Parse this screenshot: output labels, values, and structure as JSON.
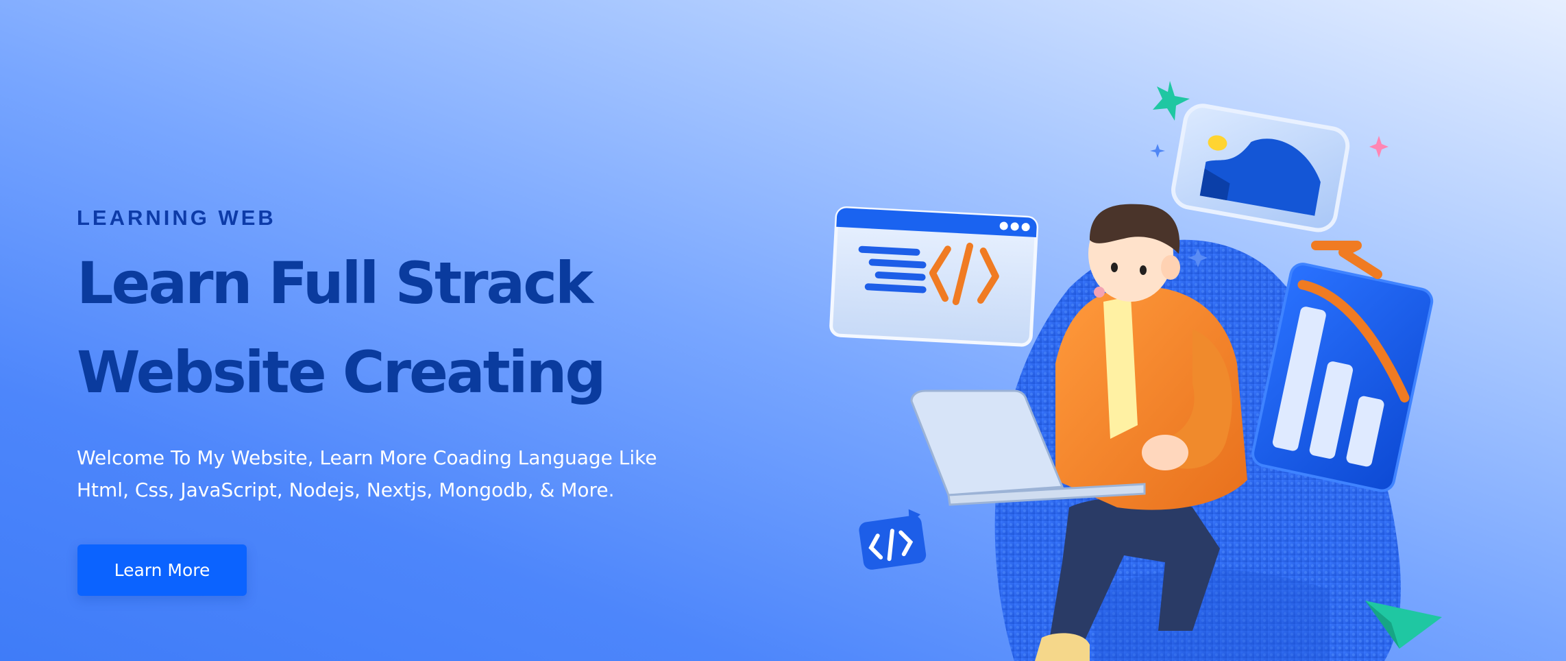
{
  "hero": {
    "eyebrow": "LEARNING WEB",
    "headline_line1": "Learn Full Strack",
    "headline_line2": "Website Creating",
    "description_line1": "Welcome To My Website, Learn More Coading Language Like",
    "description_line2": "Html, Css, JavaScript, Nodejs, Nextjs, Mongodb, & More.",
    "cta_label": "Learn More"
  },
  "illustration": {
    "subject": "3d-developer-with-laptop-on-chair",
    "icons": [
      "code-window-icon",
      "image-card-icon",
      "bar-chart-icon",
      "code-chat-bubble-icon",
      "sparkle-icon",
      "paper-plane-icon"
    ]
  },
  "colors": {
    "heading": "#0a3b9e",
    "eyebrow": "#0d3ba8",
    "button": "#0b63ff",
    "orange": "#f07b22",
    "teal": "#1fc7a2"
  }
}
